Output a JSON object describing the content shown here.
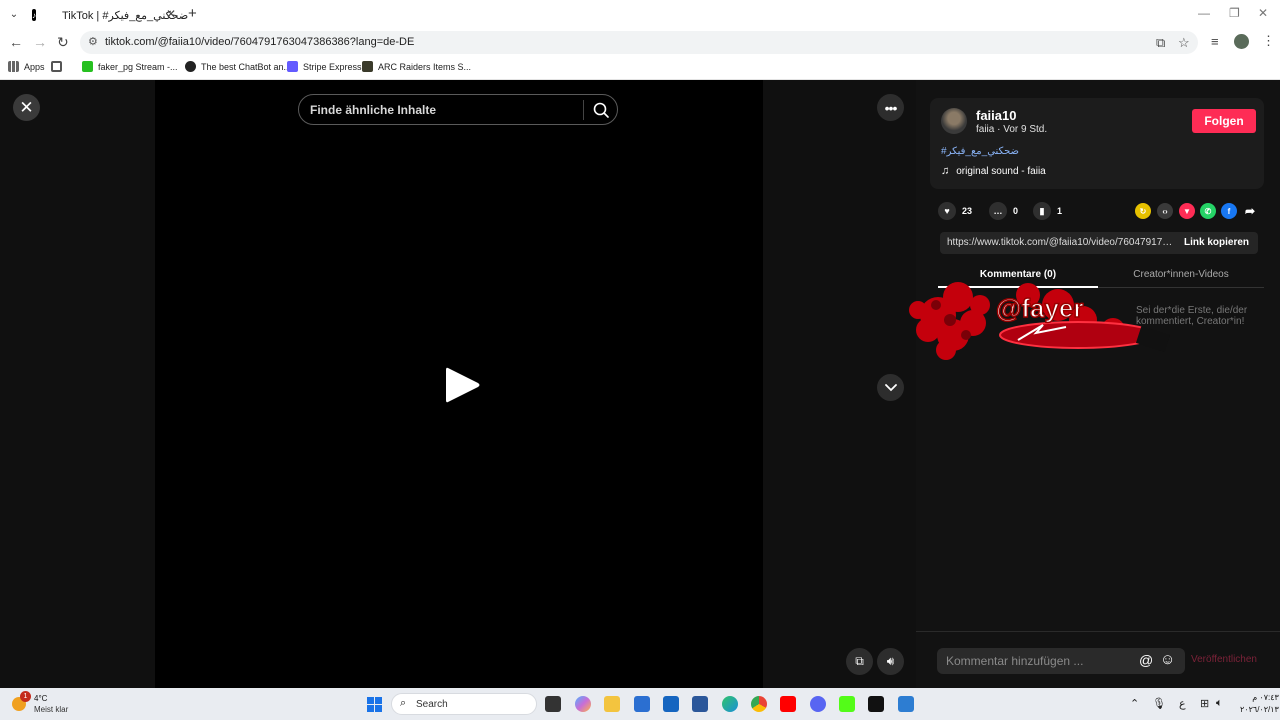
{
  "browser": {
    "tab_title": "TikTok | #ضحكني_مع_فيكر",
    "url": "tiktok.com/@faiia10/video/7604791763047386386?lang=de-DE",
    "bookmarks": [
      {
        "label": "Apps"
      },
      {
        "label": "faker_pg Stream -..."
      },
      {
        "label": "The best ChatBot an..."
      },
      {
        "label": "Stripe Express"
      },
      {
        "label": "ARC Raiders Items S..."
      }
    ]
  },
  "video": {
    "search_placeholder": "Finde ähnliche Inhalte"
  },
  "post": {
    "username": "faiia10",
    "subtitle": "faiia · Vor 9 Std.",
    "follow_label": "Folgen",
    "hashtag": "#ضحكني_مع_فيكر",
    "sound": "original sound - faiia",
    "likes": "23",
    "comments": "0",
    "saves": "1",
    "link_url": "https://www.tiktok.com/@faiia10/video/7604791763047386386",
    "copy_link_label": "Link kopieren",
    "tab_comments": "Kommentare (0)",
    "tab_creator": "Creator*innen-Videos",
    "empty_hint": "Sei der*die Erste, die/der kommentiert, Creator*in!",
    "sticker_text": "@fayer",
    "comment_placeholder": "Kommentar hinzufügen ...",
    "publish_label": "Veröffentlichen"
  },
  "taskbar": {
    "weather_temp": "4°C",
    "weather_desc": "Meist klar",
    "weather_badge": "1",
    "search_label": "Search",
    "time": "٠٧:٤٣ م",
    "date": "٢٠٢٦/٠٢/١٣"
  }
}
